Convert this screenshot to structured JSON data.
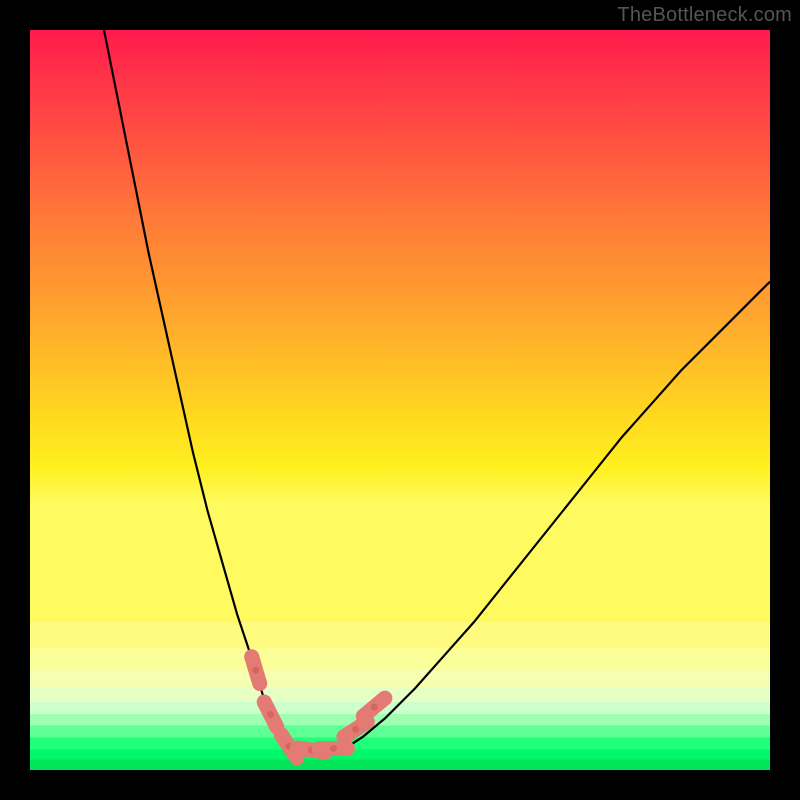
{
  "watermark": "TheBottleneck.com",
  "chart_data": {
    "type": "line",
    "title": "",
    "xlabel": "",
    "ylabel": "",
    "xlim": [
      0,
      100
    ],
    "ylim": [
      0,
      100
    ],
    "legend": false,
    "series": [
      {
        "name": "curve",
        "x": [
          10,
          12,
          14,
          16,
          18,
          20,
          22,
          24,
          26,
          28,
          30,
          31.5,
          33,
          35,
          37,
          39,
          41,
          43,
          45,
          48,
          52,
          56,
          60,
          64,
          68,
          72,
          76,
          80,
          84,
          88,
          92,
          96,
          100
        ],
        "y": [
          100,
          90,
          80,
          70,
          61,
          52,
          43,
          35,
          28,
          21,
          15,
          10,
          7,
          4,
          3,
          2.7,
          2.7,
          3.2,
          4.5,
          7,
          11,
          15.5,
          20,
          25,
          30,
          35,
          40,
          45,
          49.5,
          54,
          58,
          62,
          66
        ]
      }
    ],
    "markers": [
      {
        "name": "pink-segment-left-upper",
        "x": 30.5,
        "y": 13.5
      },
      {
        "name": "pink-segment-left-lower",
        "x": 32.5,
        "y": 7.5
      },
      {
        "name": "pink-bottom-left",
        "x": 35,
        "y": 3.2
      },
      {
        "name": "pink-bottom-mid",
        "x": 38,
        "y": 2.7
      },
      {
        "name": "pink-bottom-right",
        "x": 41,
        "y": 2.9
      },
      {
        "name": "pink-segment-right-lower",
        "x": 44,
        "y": 5.5
      },
      {
        "name": "pink-segment-right-upper",
        "x": 46.5,
        "y": 8.5
      }
    ],
    "background": {
      "type": "vertical-gradient",
      "stops": [
        {
          "pos": 0,
          "color": "#ff1a4d"
        },
        {
          "pos": 20,
          "color": "#ff5640"
        },
        {
          "pos": 44,
          "color": "#ff9a30"
        },
        {
          "pos": 65,
          "color": "#ffd820"
        },
        {
          "pos": 80,
          "color": "#fffa80"
        },
        {
          "pos": 90,
          "color": "#9effb0"
        },
        {
          "pos": 100,
          "color": "#00e658"
        }
      ]
    }
  }
}
